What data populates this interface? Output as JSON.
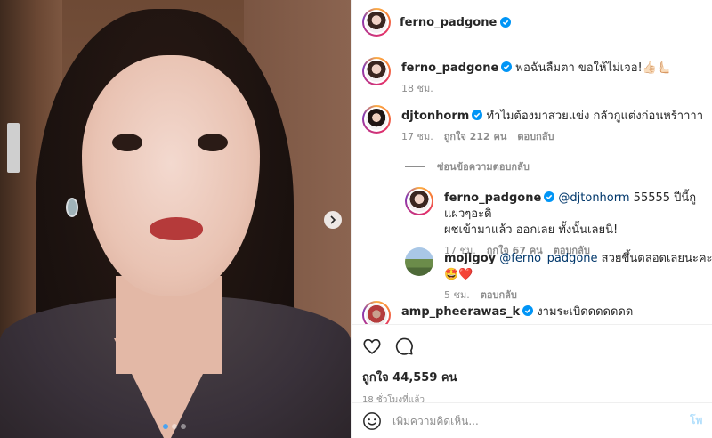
{
  "post": {
    "author": "ferno_padgone",
    "carousel_count": 3,
    "carousel_active": 1
  },
  "caption": {
    "username": "ferno_padgone",
    "text": "พอฉันลืมตา ขอให้ไม่เจอ!👍🏻🫷🏻",
    "time": "18 ชม."
  },
  "comments": [
    {
      "username": "djtonhorm",
      "text": "ทำไมต้องมาสวยแข่ง กลัวกูแต่งก่อนหร้าาาา",
      "time": "17 ชม.",
      "likes": "ถูกใจ 212 คน",
      "reply": "ตอบกลับ"
    }
  ],
  "hide_replies": "ซ่อนข้อความตอบกลับ",
  "replies": [
    {
      "username": "ferno_padgone",
      "mention": "@djtonhorm",
      "text_line1": " 55555 ปีนี้กูแผ่วๆอะดิ",
      "text_line2": "ผชเข้ามาแล้ว ออกเลย ทั้งนั้นเลยนิ!",
      "time": "17 ชม.",
      "likes": "ถูกใจ 67 คน",
      "reply": "ตอบกลับ"
    },
    {
      "username": "mojigoy",
      "mention": "@ferno_padgone",
      "text": " สวยขึ้นตลอดเลยนะคะ🤩❤️",
      "time": "5 ชม.",
      "reply": "ตอบกลับ"
    }
  ],
  "partial_comment": {
    "username": "amp_pheerawas_k",
    "text": "งามระเบิดดดดดดด"
  },
  "engagement": {
    "likes": "ถูกใจ 44,559 คน",
    "time_ago": "18 ชั่วโมงที่แล้ว"
  },
  "composer": {
    "placeholder": "เพิ่มความคิดเห็น...",
    "post_label": "โพสต์"
  },
  "colors": {
    "verified": "#0095f6",
    "muted": "#8e8e8e",
    "mention": "#00376b",
    "post_disabled": "#b2dffc"
  }
}
